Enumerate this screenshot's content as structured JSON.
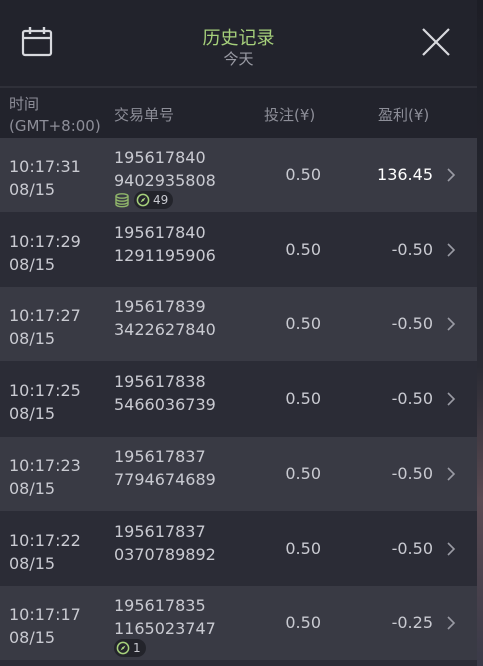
{
  "header": {
    "title": "历史记录",
    "subtitle": "今天"
  },
  "columns": {
    "time": "时间",
    "timezone": "(GMT+8:00)",
    "order": "交易单号",
    "bet": "投注(¥)",
    "profit": "盈利(¥)"
  },
  "icons": {
    "calendar": "calendar-icon",
    "close": "close-icon",
    "chevron": "chevron-right-icon",
    "coins": "coins-icon",
    "compass": "compass-icon"
  },
  "colors": {
    "accent": "#a6d07b",
    "panel": "#2b2c36",
    "header": "#22232c",
    "row_alt": "#393a44"
  },
  "rows": [
    {
      "time": "10:17:31",
      "date": "08/15",
      "order_a": "195617840",
      "order_b": "9402935808",
      "bet": "0.50",
      "profit": "136.45",
      "positive": true,
      "coins": true,
      "badge": "49"
    },
    {
      "time": "10:17:29",
      "date": "08/15",
      "order_a": "195617840",
      "order_b": "1291195906",
      "bet": "0.50",
      "profit": "-0.50"
    },
    {
      "time": "10:17:27",
      "date": "08/15",
      "order_a": "195617839",
      "order_b": "3422627840",
      "bet": "0.50",
      "profit": "-0.50"
    },
    {
      "time": "10:17:25",
      "date": "08/15",
      "order_a": "195617838",
      "order_b": "5466036739",
      "bet": "0.50",
      "profit": "-0.50"
    },
    {
      "time": "10:17:23",
      "date": "08/15",
      "order_a": "195617837",
      "order_b": "7794674689",
      "bet": "0.50",
      "profit": "-0.50"
    },
    {
      "time": "10:17:22",
      "date": "08/15",
      "order_a": "195617837",
      "order_b": "0370789892",
      "bet": "0.50",
      "profit": "-0.50"
    },
    {
      "time": "10:17:17",
      "date": "08/15",
      "order_a": "195617835",
      "order_b": "1165023747",
      "bet": "0.50",
      "profit": "-0.25",
      "badge": "1"
    }
  ]
}
